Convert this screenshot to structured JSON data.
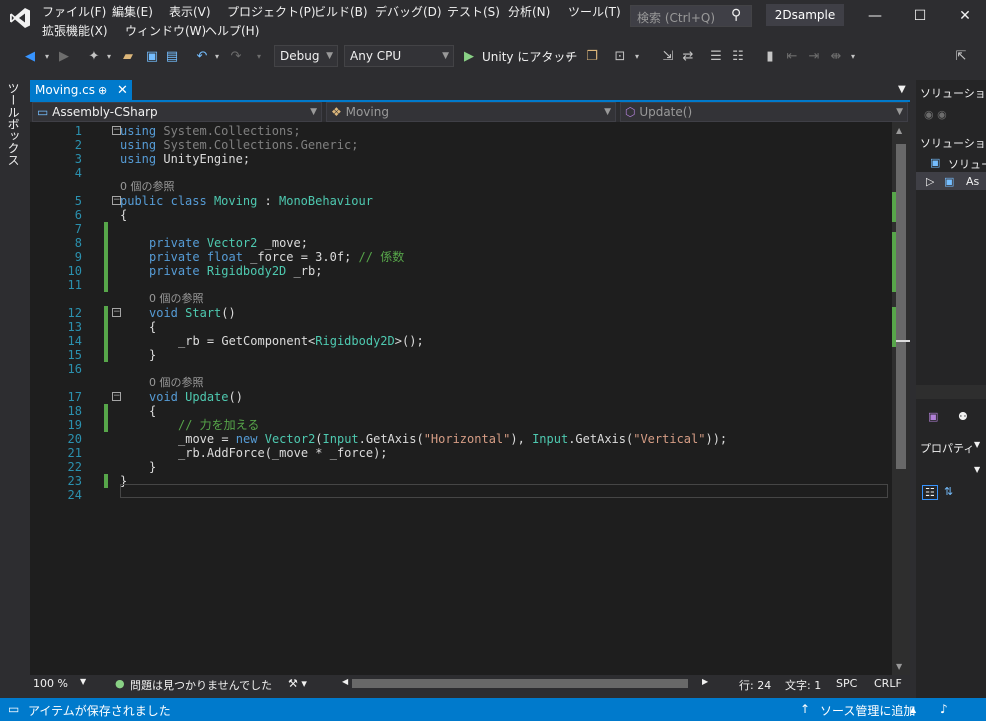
{
  "menu": [
    "ファイル(F)",
    "編集(E)",
    "表示(V)",
    "プロジェクト(P)",
    "ビルド(B)",
    "デバッグ(D)",
    "テスト(S)",
    "分析(N)",
    "ツール(T)",
    "拡張機能(X)",
    "ウィンドウ(W)",
    "ヘルプ(H)"
  ],
  "search": {
    "placeholder": "検索 (Ctrl+Q)"
  },
  "solution_name": "2Dsample",
  "toolbar": {
    "config": "Debug",
    "platform": "Any CPU",
    "attach": "Unity にアタッチ"
  },
  "toolbox_label": "ツールボックス",
  "tab": {
    "file": "Moving.cs",
    "pin": "⊕",
    "close": "✕"
  },
  "nav": {
    "project": "Assembly-CSharp",
    "class": "Moving",
    "member": "Update()"
  },
  "code": {
    "lines": [
      {
        "n": "1",
        "html": [
          [
            "kw",
            "using"
          ],
          [
            "dim",
            " System.Collections;"
          ]
        ],
        "fold": "−",
        "indent": 0
      },
      {
        "n": "2",
        "html": [
          [
            "kw",
            "using"
          ],
          [
            "dim",
            " System.Collections.Generic;"
          ]
        ],
        "indent": 0
      },
      {
        "n": "3",
        "html": [
          [
            "kw",
            "using"
          ],
          [
            "pl",
            " UnityEngine;"
          ]
        ],
        "indent": 0
      },
      {
        "n": "4",
        "html": [],
        "indent": 0
      },
      {
        "n": "5",
        "html": [
          [
            "kw",
            "public"
          ],
          [
            "pl",
            " "
          ],
          [
            "kw",
            "class"
          ],
          [
            "pl",
            " "
          ],
          [
            "ty",
            "Moving"
          ],
          [
            "pl",
            " : "
          ],
          [
            "ty",
            "MonoBehaviour"
          ]
        ],
        "fold": "−",
        "ref": "0 個の参照",
        "indent": 0
      },
      {
        "n": "6",
        "html": [
          [
            "pl",
            "{"
          ]
        ],
        "indent": 0
      },
      {
        "n": "7",
        "html": [],
        "chg": true,
        "indent": 0
      },
      {
        "n": "8",
        "html": [
          [
            "kw",
            "private"
          ],
          [
            "pl",
            " "
          ],
          [
            "ty",
            "Vector2"
          ],
          [
            "pl",
            " _move;"
          ]
        ],
        "chg": true,
        "indent": 2
      },
      {
        "n": "9",
        "html": [
          [
            "kw",
            "private"
          ],
          [
            "pl",
            " "
          ],
          [
            "kw",
            "float"
          ],
          [
            "pl",
            " _force = 3.0f; "
          ],
          [
            "cm",
            "// 係数"
          ]
        ],
        "chg": true,
        "indent": 2
      },
      {
        "n": "10",
        "html": [
          [
            "kw",
            "private"
          ],
          [
            "pl",
            " "
          ],
          [
            "ty",
            "Rigidbody2D"
          ],
          [
            "pl",
            " _rb;"
          ]
        ],
        "chg": true,
        "indent": 2
      },
      {
        "n": "11",
        "html": [],
        "chg": true,
        "indent": 0
      },
      {
        "n": "12",
        "html": [
          [
            "kw",
            "void"
          ],
          [
            "pl",
            " "
          ],
          [
            "ty",
            "Start"
          ],
          [
            "pl",
            "()"
          ]
        ],
        "fold": "−",
        "ref": "0 個の参照",
        "chg": true,
        "indent": 2
      },
      {
        "n": "13",
        "html": [
          [
            "pl",
            "{"
          ]
        ],
        "chg": true,
        "indent": 2
      },
      {
        "n": "14",
        "html": [
          [
            "pl",
            "_rb = GetComponent<"
          ],
          [
            "ty",
            "Rigidbody2D"
          ],
          [
            "pl",
            ">();"
          ]
        ],
        "chg": true,
        "indent": 4
      },
      {
        "n": "15",
        "html": [
          [
            "pl",
            "}"
          ]
        ],
        "chg": true,
        "indent": 2
      },
      {
        "n": "16",
        "html": [],
        "indent": 0
      },
      {
        "n": "17",
        "html": [
          [
            "kw",
            "void"
          ],
          [
            "pl",
            " "
          ],
          [
            "ty",
            "Update"
          ],
          [
            "pl",
            "()"
          ]
        ],
        "fold": "−",
        "ref": "0 個の参照",
        "indent": 2
      },
      {
        "n": "18",
        "html": [
          [
            "pl",
            "{"
          ]
        ],
        "chg": true,
        "indent": 2
      },
      {
        "n": "19",
        "html": [
          [
            "cm",
            "// 力を加える"
          ]
        ],
        "chg": true,
        "indent": 4
      },
      {
        "n": "20",
        "html": [
          [
            "pl",
            "_move = "
          ],
          [
            "kw",
            "new"
          ],
          [
            "pl",
            " "
          ],
          [
            "ty",
            "Vector2"
          ],
          [
            "pl",
            "("
          ],
          [
            "ty",
            "Input"
          ],
          [
            "pl",
            ".GetAxis("
          ],
          [
            "st",
            "\"Horizontal\""
          ],
          [
            "pl",
            "), "
          ],
          [
            "ty",
            "Input"
          ],
          [
            "pl",
            ".GetAxis("
          ],
          [
            "st",
            "\"Vertical\""
          ],
          [
            "pl",
            "));"
          ]
        ],
        "indent": 4
      },
      {
        "n": "21",
        "html": [
          [
            "pl",
            "_rb.AddForce(_move * _force);"
          ]
        ],
        "indent": 4
      },
      {
        "n": "22",
        "html": [
          [
            "pl",
            "}"
          ]
        ],
        "indent": 2
      },
      {
        "n": "23",
        "html": [
          [
            "pl",
            "}"
          ]
        ],
        "chg": true,
        "indent": 0
      },
      {
        "n": "24",
        "html": [],
        "indent": 0
      }
    ]
  },
  "editor_status": {
    "zoom": "100 %",
    "issues": "問題は見つかりませんでした",
    "line": "行: 24",
    "col": "文字: 1",
    "mode": "SPC",
    "eol": "CRLF"
  },
  "right_panel": {
    "title1": "ソリューショ...",
    "title2": "ソリューション",
    "item1": "ソリュー",
    "item2": "As",
    "props": "プロパティ"
  },
  "statusbar": {
    "message": "アイテムが保存されました",
    "source_control": "ソース管理に追加"
  }
}
